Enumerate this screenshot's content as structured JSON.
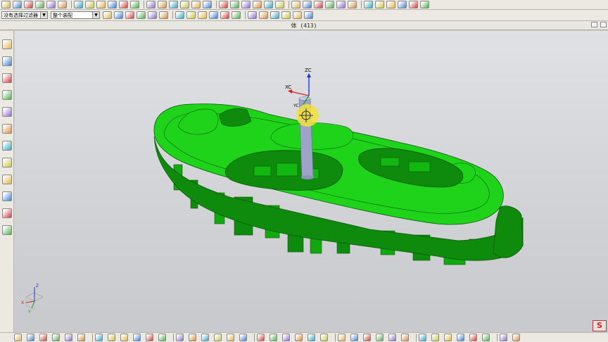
{
  "selection_bar": {
    "filter_value": "没有选择过滤器",
    "assembly_value": "整个装配"
  },
  "graphics_window": {
    "title": "体 (413)"
  },
  "wcs_labels": {
    "x": "XC",
    "y": "YC",
    "z": "ZC"
  },
  "triad_labels": {
    "z": "Z",
    "x": "X",
    "y": "Y"
  },
  "colors": {
    "part_green": "#1ed31a",
    "part_dark": "#0e8a0c",
    "part_edge": "#0a5a08",
    "handle_yellow": "#f2e23a",
    "axis_x": "#d42020",
    "axis_y": "#1c9c1c",
    "axis_z": "#1f35d8",
    "background_top": "#e0e1e5"
  },
  "icons": {
    "top_toolbar": [
      "snap-icon",
      "sketch-icon",
      "extrude-icon",
      "color-icon",
      "layer-icon",
      "cube-icon",
      "box-icon",
      "hole-icon",
      "draft-icon",
      "group-icon",
      "sync-icon",
      "expression-icon",
      "measure-icon",
      "grid-icon",
      "align-icon",
      "transform-icon",
      "plane-icon",
      "axis-icon",
      "point-icon",
      "csys-icon",
      "shell-icon",
      "mirror-icon",
      "pattern-icon",
      "trim-icon",
      "offset-icon",
      "blend-icon",
      "chamfer-icon",
      "delete-icon",
      "replace-icon",
      "view-icon",
      "render-icon",
      "shade-icon",
      "wireframe-icon",
      "zoom-icon",
      "rotate-icon",
      "pan-icon"
    ],
    "left_toolbar": [
      "assembly-icon",
      "navigator-icon",
      "constraint-icon",
      "history-icon",
      "part-icon",
      "info-icon",
      "web-icon",
      "clock-icon",
      "reuse-icon",
      "palette-icon",
      "role-icon",
      "system-icon"
    ],
    "bottom_toolbar": [
      "face-icon",
      "edge-icon",
      "curve-icon",
      "point-snap-icon",
      "midpoint-icon",
      "center-icon",
      "quadrant-icon",
      "intersect-icon",
      "tangent-icon",
      "arc-icon",
      "end-icon",
      "existing-icon",
      "vertex-icon",
      "grid-snap-icon",
      "plane-snap-icon",
      "bounded-icon",
      "extend-icon",
      "split-icon",
      "join-icon",
      "break-icon",
      "fit-icon",
      "offset-face-icon",
      "region-icon",
      "surface-icon",
      "body-icon",
      "feature-icon",
      "sheet-icon",
      "solid-icon",
      "mesh-icon",
      "section-icon",
      "clip-icon",
      "analysis-icon",
      "deviation-icon",
      "curvature-icon",
      "draft-check-icon",
      "thickness-icon",
      "interference-icon",
      "clearance-icon"
    ]
  }
}
